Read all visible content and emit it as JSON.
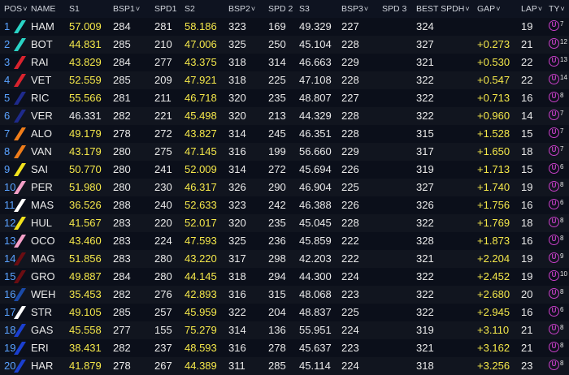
{
  "headers": [
    "POS",
    "NAME",
    "S1",
    "BSP1",
    "SPD1",
    "S2",
    "BSP2",
    "SPD 2",
    "S3",
    "BSP3",
    "SPD 3",
    "BEST SPDH",
    "GAP",
    "LAP",
    "TY"
  ],
  "rows": [
    {
      "pos": "1",
      "name": "HAM",
      "s1": "57.009",
      "bsp1": "284",
      "spd1": "281",
      "s2": "58.186",
      "bsp2": "323",
      "spd2": "169",
      "s3": "49.329",
      "bsp3": "227",
      "best": "324",
      "gap": "",
      "lap": "19",
      "tyre": "U",
      "tlaps": "7",
      "color": "#2ad4c6"
    },
    {
      "pos": "2",
      "name": "BOT",
      "s1": "44.831",
      "bsp1": "285",
      "spd1": "210",
      "s2": "47.006",
      "bsp2": "325",
      "spd2": "250",
      "s3": "45.104",
      "bsp3": "228",
      "best": "327",
      "gap": "+0.273",
      "lap": "21",
      "tyre": "U",
      "tlaps": "12",
      "color": "#2ad4c6"
    },
    {
      "pos": "3",
      "name": "RAI",
      "s1": "43.829",
      "bsp1": "284",
      "spd1": "277",
      "s2": "43.375",
      "bsp2": "318",
      "spd2": "314",
      "s3": "46.663",
      "bsp3": "229",
      "best": "321",
      "gap": "+0.530",
      "lap": "22",
      "tyre": "U",
      "tlaps": "13",
      "color": "#d9232e"
    },
    {
      "pos": "4",
      "name": "VET",
      "s1": "52.559",
      "bsp1": "285",
      "spd1": "209",
      "s2": "47.921",
      "bsp2": "318",
      "spd2": "225",
      "s3": "47.108",
      "bsp3": "228",
      "best": "322",
      "gap": "+0.547",
      "lap": "22",
      "tyre": "U",
      "tlaps": "14",
      "color": "#d9232e"
    },
    {
      "pos": "5",
      "name": "RIC",
      "s1": "55.566",
      "bsp1": "281",
      "spd1": "211",
      "s2": "46.718",
      "bsp2": "320",
      "spd2": "235",
      "s3": "48.807",
      "bsp3": "227",
      "best": "322",
      "gap": "+0.713",
      "lap": "16",
      "tyre": "U",
      "tlaps": "8",
      "color": "#1e2a8c"
    },
    {
      "pos": "6",
      "name": "VER",
      "s1": "46.331",
      "s1c": "white",
      "bsp1": "282",
      "spd1": "221",
      "s2": "45.498",
      "bsp2": "320",
      "spd2": "213",
      "s3": "44.329",
      "bsp3": "228",
      "best": "322",
      "gap": "+0.960",
      "lap": "14",
      "tyre": "U",
      "tlaps": "7",
      "color": "#1e2a8c"
    },
    {
      "pos": "7",
      "name": "ALO",
      "s1": "49.179",
      "bsp1": "278",
      "spd1": "272",
      "s2": "43.827",
      "bsp2": "314",
      "spd2": "245",
      "s3": "46.351",
      "bsp3": "228",
      "best": "315",
      "gap": "+1.528",
      "lap": "15",
      "tyre": "U",
      "tlaps": "7",
      "color": "#f07d1a"
    },
    {
      "pos": "8",
      "name": "VAN",
      "s1": "43.179",
      "bsp1": "280",
      "spd1": "275",
      "s2": "47.145",
      "bsp2": "316",
      "spd2": "199",
      "s3": "56.660",
      "bsp3": "229",
      "best": "317",
      "gap": "+1.650",
      "lap": "18",
      "tyre": "U",
      "tlaps": "7",
      "color": "#f07d1a"
    },
    {
      "pos": "9",
      "name": "SAI",
      "s1": "50.770",
      "bsp1": "280",
      "spd1": "241",
      "s2": "52.009",
      "bsp2": "314",
      "spd2": "272",
      "s3": "45.694",
      "bsp3": "226",
      "best": "319",
      "gap": "+1.713",
      "lap": "15",
      "tyre": "U",
      "tlaps": "6",
      "color": "#f2e21d"
    },
    {
      "pos": "10",
      "name": "PER",
      "s1": "51.980",
      "bsp1": "280",
      "spd1": "230",
      "s2": "46.317",
      "bsp2": "326",
      "spd2": "290",
      "s3": "46.904",
      "bsp3": "225",
      "best": "327",
      "gap": "+1.740",
      "lap": "19",
      "tyre": "U",
      "tlaps": "8",
      "color": "#f4a0c8"
    },
    {
      "pos": "11",
      "name": "MAS",
      "s1": "36.526",
      "bsp1": "288",
      "spd1": "240",
      "s2": "52.633",
      "bsp2": "323",
      "spd2": "242",
      "s3": "46.388",
      "bsp3": "226",
      "best": "326",
      "gap": "+1.756",
      "lap": "16",
      "tyre": "U",
      "tlaps": "6",
      "color": "#ffffff"
    },
    {
      "pos": "12",
      "name": "HUL",
      "s1": "41.567",
      "bsp1": "283",
      "spd1": "220",
      "s2": "52.017",
      "bsp2": "320",
      "spd2": "235",
      "s3": "45.045",
      "bsp3": "228",
      "best": "322",
      "gap": "+1.769",
      "lap": "18",
      "tyre": "U",
      "tlaps": "8",
      "color": "#f2e21d"
    },
    {
      "pos": "13",
      "name": "OCO",
      "s1": "43.460",
      "bsp1": "283",
      "spd1": "224",
      "s2": "47.593",
      "bsp2": "325",
      "spd2": "236",
      "s3": "45.859",
      "bsp3": "222",
      "best": "328",
      "gap": "+1.873",
      "lap": "16",
      "tyre": "U",
      "tlaps": "8",
      "color": "#f4a0c8"
    },
    {
      "pos": "14",
      "name": "MAG",
      "s1": "51.856",
      "bsp1": "283",
      "spd1": "280",
      "s2": "43.220",
      "bsp2": "317",
      "spd2": "298",
      "s3": "42.203",
      "bsp3": "222",
      "best": "321",
      "gap": "+2.204",
      "lap": "19",
      "tyre": "U",
      "tlaps": "9",
      "color": "#6b0d12"
    },
    {
      "pos": "15",
      "name": "GRO",
      "s1": "49.887",
      "bsp1": "284",
      "spd1": "280",
      "s2": "44.145",
      "bsp2": "318",
      "spd2": "294",
      "s3": "44.300",
      "bsp3": "224",
      "best": "322",
      "gap": "+2.452",
      "lap": "19",
      "tyre": "U",
      "tlaps": "10",
      "color": "#6b0d12"
    },
    {
      "pos": "16",
      "name": "WEH",
      "s1": "35.453",
      "bsp1": "282",
      "spd1": "276",
      "s2": "42.893",
      "bsp2": "316",
      "spd2": "315",
      "s3": "48.068",
      "bsp3": "223",
      "best": "322",
      "gap": "+2.680",
      "lap": "20",
      "tyre": "U",
      "tlaps": "8",
      "color": "#1a4aa8"
    },
    {
      "pos": "17",
      "name": "STR",
      "s1": "49.105",
      "bsp1": "285",
      "spd1": "257",
      "s2": "45.959",
      "bsp2": "322",
      "spd2": "204",
      "s3": "48.837",
      "bsp3": "225",
      "best": "322",
      "gap": "+2.945",
      "lac": "",
      "lap": "16",
      "tyre": "U",
      "tlaps": "6",
      "color": "#ffffff"
    },
    {
      "pos": "18",
      "name": "GAS",
      "s1": "45.558",
      "bsp1": "277",
      "spd1": "155",
      "s2": "75.279",
      "bsp2": "314",
      "spd2": "136",
      "s3": "55.951",
      "bsp3": "224",
      "best": "319",
      "gap": "+3.110",
      "lap": "21",
      "tyre": "U",
      "tlaps": "8",
      "color": "#1a3fd0"
    },
    {
      "pos": "19",
      "name": "ERI",
      "s1": "38.431",
      "bsp1": "282",
      "spd1": "237",
      "s2": "48.593",
      "bsp2": "316",
      "spd2": "278",
      "s3": "45.637",
      "bsp3": "223",
      "best": "321",
      "gap": "+3.162",
      "lap": "21",
      "tyre": "U",
      "tlaps": "8",
      "color": "#1a3fd0"
    },
    {
      "pos": "20",
      "name": "HAR",
      "s1": "41.879",
      "bsp1": "278",
      "spd1": "267",
      "s2": "44.389",
      "bsp2": "311",
      "spd2": "285",
      "s3": "45.114",
      "bsp3": "224",
      "best": "318",
      "gap": "+3.256",
      "lap": "23",
      "tyre": "U",
      "tlaps": "8",
      "color": "#1a3fd0"
    }
  ],
  "colors": {
    "highlight": "#f5e84a",
    "tyre": "#c93fc9",
    "position": "#5aa2ff"
  }
}
